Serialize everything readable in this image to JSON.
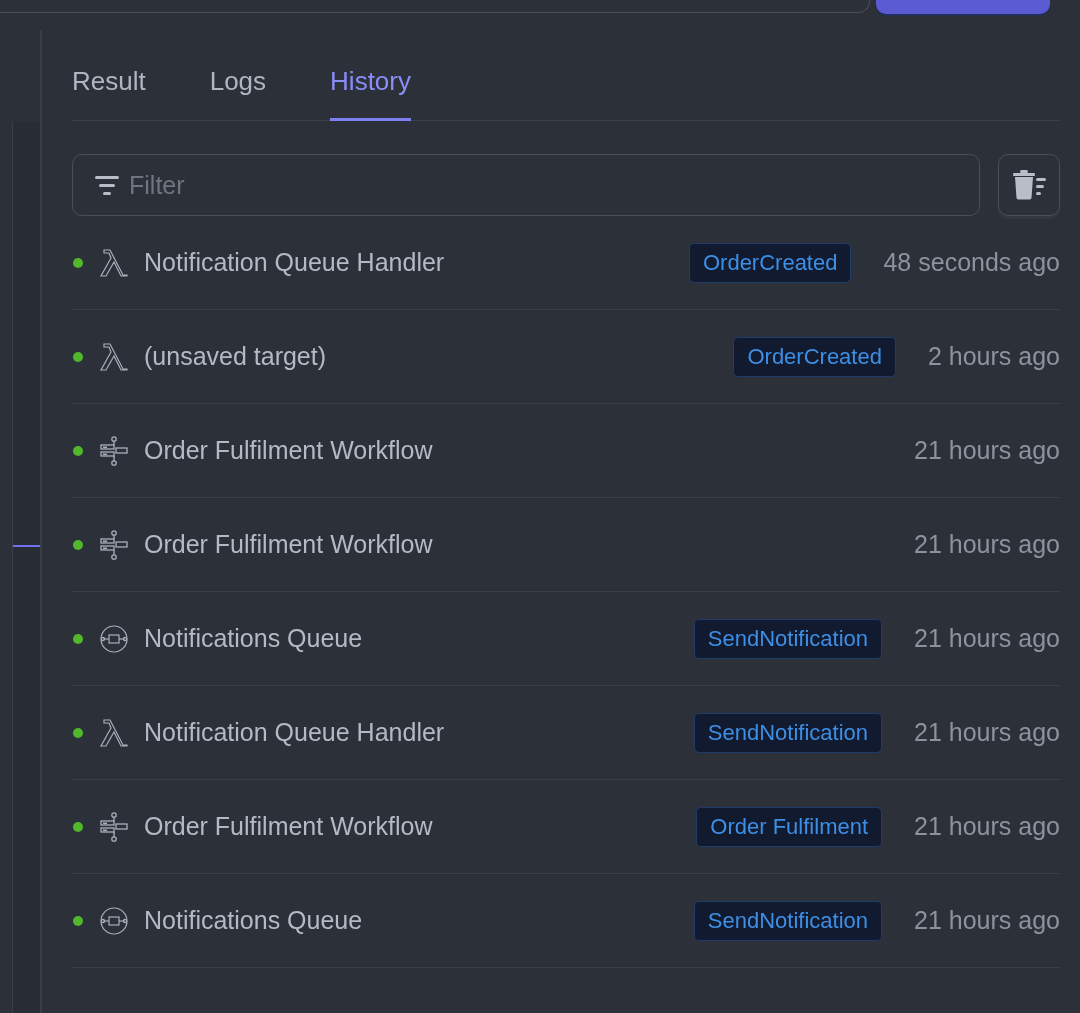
{
  "tabs": [
    {
      "label": "Result",
      "selected": false
    },
    {
      "label": "Logs",
      "selected": false
    },
    {
      "label": "History",
      "selected": true
    }
  ],
  "filter": {
    "placeholder": "Filter"
  },
  "history": [
    {
      "kind": "lambda",
      "name": "Notification Queue Handler",
      "tag": "OrderCreated",
      "time": "48 seconds ago"
    },
    {
      "kind": "lambda",
      "name": "(unsaved target)",
      "tag": "OrderCreated",
      "time": "2 hours ago"
    },
    {
      "kind": "workflow",
      "name": "Order Fulfilment Workflow",
      "time": "21 hours ago"
    },
    {
      "kind": "workflow",
      "name": "Order Fulfilment Workflow",
      "time": "21 hours ago"
    },
    {
      "kind": "queue",
      "name": "Notifications Queue",
      "tag": "SendNotification",
      "time": "21 hours ago"
    },
    {
      "kind": "lambda",
      "name": "Notification Queue Handler",
      "tag": "SendNotification",
      "time": "21 hours ago"
    },
    {
      "kind": "workflow",
      "name": "Order Fulfilment Workflow",
      "tag": "Order Fulfilment",
      "time": "21 hours ago"
    },
    {
      "kind": "queue",
      "name": "Notifications Queue",
      "tag": "SendNotification",
      "time": "21 hours ago"
    }
  ]
}
